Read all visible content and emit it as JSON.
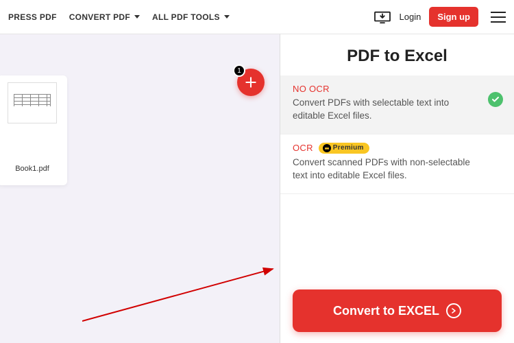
{
  "header": {
    "nav": {
      "compress": "PRESS PDF",
      "convert": "CONVERT PDF",
      "tools": "ALL PDF TOOLS"
    },
    "login": "Login",
    "signup": "Sign up"
  },
  "workspace": {
    "file_name": "Book1.pdf",
    "add_count": "1"
  },
  "panel": {
    "title": "PDF to Excel",
    "options": [
      {
        "title": "NO OCR",
        "desc": "Convert PDFs with selectable text into editable Excel files."
      },
      {
        "title": "OCR",
        "premium_label": "Premium",
        "desc": "Convert scanned PDFs with non-selectable text into editable Excel files."
      }
    ],
    "convert_label": "Convert to EXCEL"
  }
}
